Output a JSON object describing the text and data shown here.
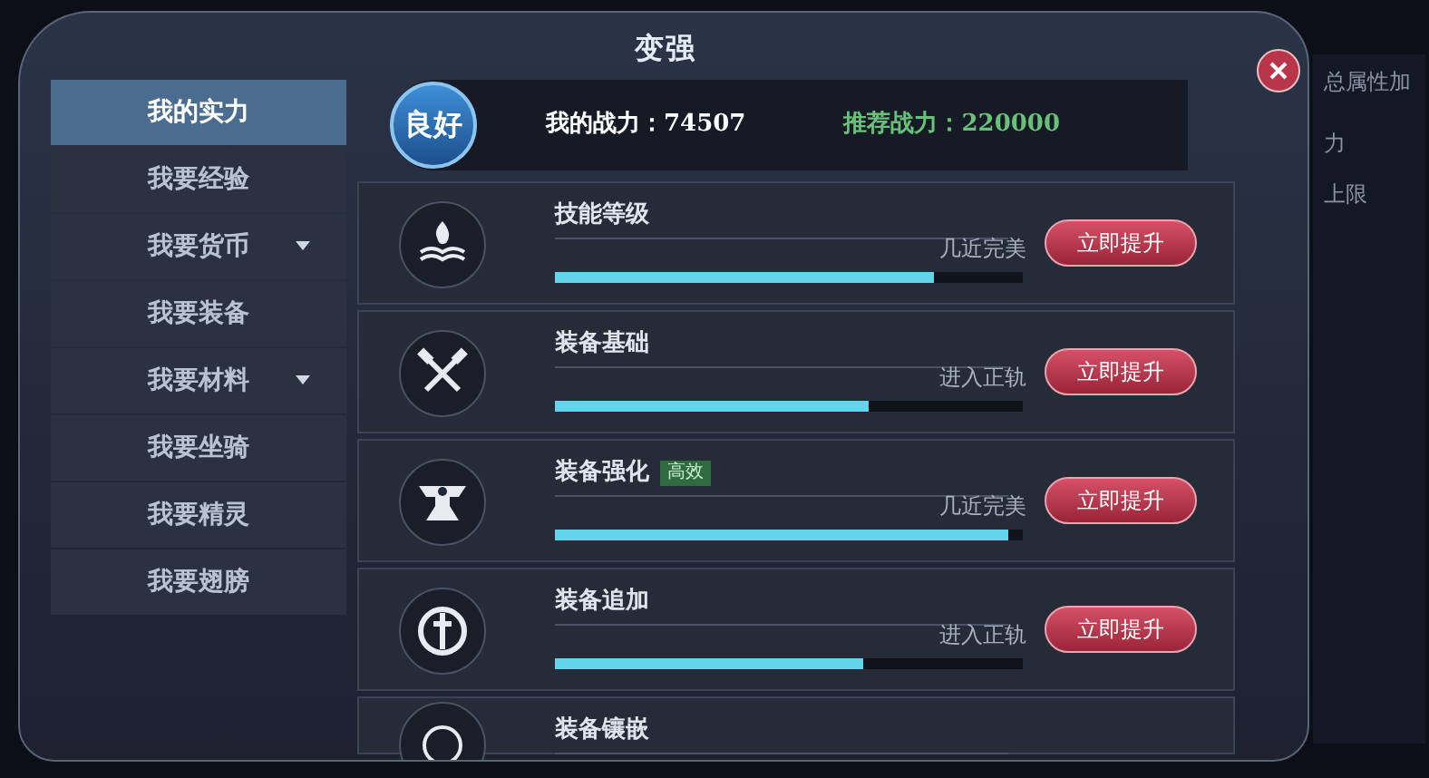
{
  "window": {
    "title": "变强"
  },
  "sidebar": {
    "items": [
      {
        "label": "我的实力",
        "selected": true,
        "has_submenu": false
      },
      {
        "label": "我要经验",
        "selected": false,
        "has_submenu": false
      },
      {
        "label": "我要货币",
        "selected": false,
        "has_submenu": true
      },
      {
        "label": "我要装备",
        "selected": false,
        "has_submenu": false
      },
      {
        "label": "我要材料",
        "selected": false,
        "has_submenu": true
      },
      {
        "label": "我要坐骑",
        "selected": false,
        "has_submenu": false
      },
      {
        "label": "我要精灵",
        "selected": false,
        "has_submenu": false
      },
      {
        "label": "我要翅膀",
        "selected": false,
        "has_submenu": false
      }
    ]
  },
  "summary": {
    "rating": "良好",
    "my_power": "我的战力：74507",
    "recommended_power": "推荐战力：220000"
  },
  "rows": [
    {
      "name": "技能等级",
      "level": 0.81,
      "status": "几近完美",
      "button": "立即提升"
    },
    {
      "name": "装备基础",
      "level": 0.67,
      "status": "进入正轨",
      "button": "立即提升"
    },
    {
      "name": "装备强化",
      "badge": "高效",
      "level": 0.97,
      "status": "几近完美",
      "button": "立即提升"
    },
    {
      "name": "装备追加",
      "level": 0.66,
      "status": "进入正轨",
      "button": "立即提升"
    },
    {
      "name": "装备镶嵌"
    }
  ],
  "background_panel": {
    "title": "总属性加",
    "lines": [
      "力",
      "上限"
    ]
  }
}
